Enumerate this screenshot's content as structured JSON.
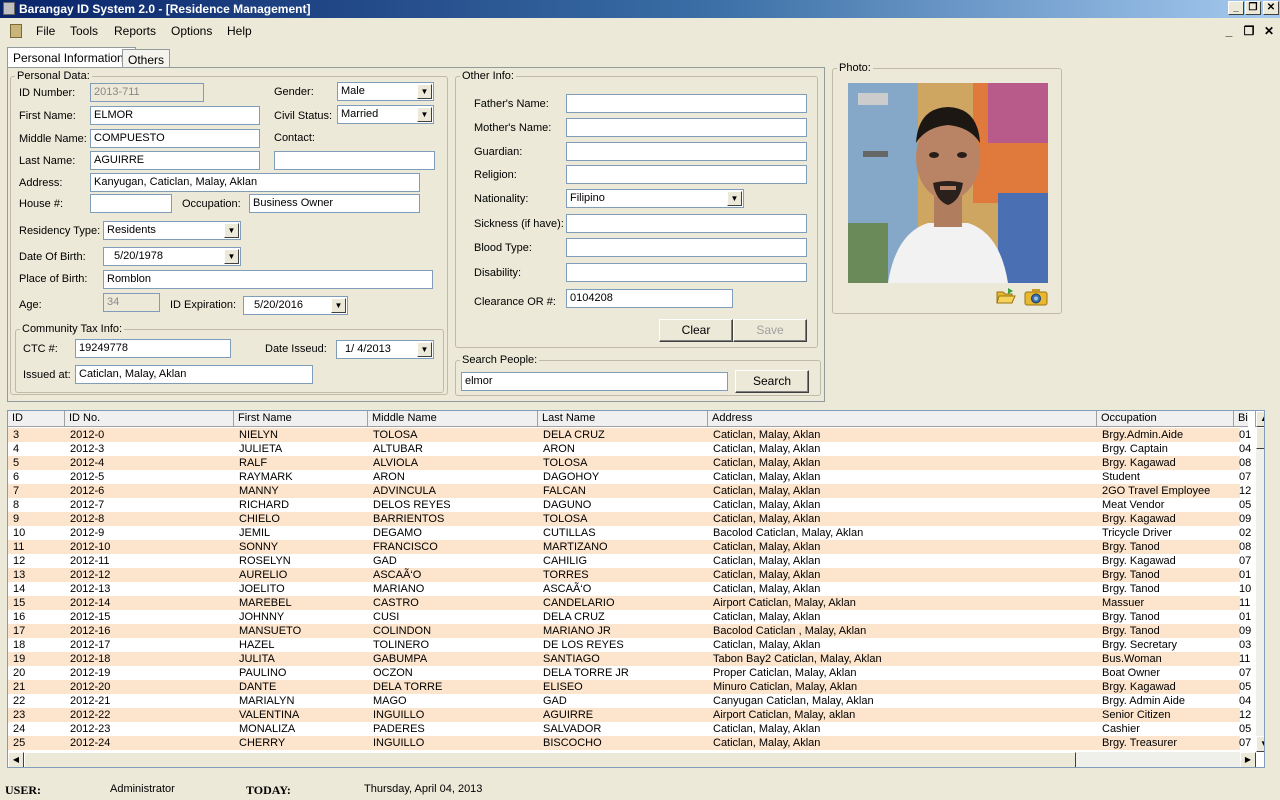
{
  "window": {
    "title": "Barangay ID System 2.0 - [Residence Management]"
  },
  "menu": [
    "File",
    "Tools",
    "Reports",
    "Options",
    "Help"
  ],
  "tabs": [
    "Personal Informations",
    "Others"
  ],
  "personal": {
    "legend": "Personal Data:",
    "id_label": "ID Number:",
    "id_value": "2013-711",
    "first_label": "First Name:",
    "first_value": "ELMOR",
    "middle_label": "Middle Name:",
    "middle_value": "COMPUESTO",
    "last_label": "Last Name:",
    "last_value": "AGUIRRE",
    "gender_label": "Gender:",
    "gender_value": "Male",
    "civil_label": "Civil Status:",
    "civil_value": "Married",
    "contact_label": "Contact:",
    "contact_value": "",
    "address_label": "Address:",
    "address_value": "Kanyugan, Caticlan, Malay, Aklan",
    "house_label": "House #:",
    "house_value": "",
    "occupation_label": "Occupation:",
    "occupation_value": "Business Owner",
    "residency_label": "Residency Type:",
    "residency_value": "Residents",
    "dob_label": "Date Of Birth:",
    "dob_value": "5/20/1978",
    "pob_label": "Place of Birth:",
    "pob_value": "Romblon",
    "age_label": "Age:",
    "age_value": "34",
    "idexp_label": "ID Expiration:",
    "idexp_value": "5/20/2016"
  },
  "ctc": {
    "legend": "Community Tax Info:",
    "ctc_label": "CTC #:",
    "ctc_value": "19249778",
    "issued_date_label": "Date Isseud:",
    "issued_date_value": "1/ 4/2013",
    "issued_at_label": "Issued at:",
    "issued_at_value": "Caticlan, Malay, Aklan"
  },
  "other": {
    "legend": "Other Info:",
    "father_label": "Father's Name:",
    "father_value": "",
    "mother_label": "Mother's Name:",
    "mother_value": "",
    "guardian_label": "Guardian:",
    "guardian_value": "",
    "religion_label": "Religion:",
    "religion_value": "",
    "nationality_label": "Nationality:",
    "nationality_value": "Filipino",
    "sickness_label": "Sickness (if have):",
    "sickness_value": "",
    "blood_label": "Blood Type:",
    "blood_value": "",
    "disability_label": "Disability:",
    "disability_value": "",
    "clearance_label": "Clearance OR #:",
    "clearance_value": "0104208",
    "clear_btn": "Clear",
    "save_btn": "Save"
  },
  "search": {
    "legend": "Search People:",
    "value": "elmor",
    "button": "Search"
  },
  "photo": {
    "legend": "Photo:",
    "open_icon": "folder-open-icon",
    "camera_icon": "camera-icon"
  },
  "grid": {
    "columns": [
      "ID",
      "ID No.",
      "First Name",
      "Middle Name",
      "Last Name",
      "Address",
      "Occupation",
      "Bi"
    ],
    "rows": [
      [
        "3",
        "2012-0",
        "NIELYN",
        "TOLOSA",
        "DELA CRUZ",
        "Caticlan, Malay, Aklan",
        "Brgy.Admin.Aide",
        "01"
      ],
      [
        "4",
        "2012-3",
        "JULIETA",
        "ALTUBAR",
        "ARON",
        "Caticlan, Malay, Aklan",
        "Brgy. Captain",
        "04"
      ],
      [
        "5",
        "2012-4",
        "RALF",
        "ALVIOLA",
        "TOLOSA",
        "Caticlan, Malay, Aklan",
        "Brgy. Kagawad",
        "08"
      ],
      [
        "6",
        "2012-5",
        "RAYMARK",
        "ARON",
        "DAGOHOY",
        "Caticlan, Malay, Aklan",
        "Student",
        "07"
      ],
      [
        "7",
        "2012-6",
        "MANNY",
        "ADVINCULA",
        "FALCAN",
        "Caticlan, Malay, Aklan",
        "2GO Travel Employee",
        "12"
      ],
      [
        "8",
        "2012-7",
        "RICHARD",
        "DELOS REYES",
        "DAGUNO",
        "Caticlan, Malay, Aklan",
        "Meat Vendor",
        "05"
      ],
      [
        "9",
        "2012-8",
        "CHIELO",
        "BARRIENTOS",
        "TOLOSA",
        "Caticlan, Malay, Aklan",
        "Brgy. Kagawad",
        "09"
      ],
      [
        "10",
        "2012-9",
        "JEMIL",
        "DEGAMO",
        "CUTILLAS",
        "Bacolod Caticlan, Malay, Aklan",
        "Tricycle Driver",
        "02"
      ],
      [
        "11",
        "2012-10",
        "SONNY",
        "FRANCISCO",
        "MARTIZANO",
        "Caticlan, Malay, Aklan",
        "Brgy. Tanod",
        "08"
      ],
      [
        "12",
        "2012-11",
        "ROSELYN",
        "GAD",
        "CAHILIG",
        "Caticlan, Malay, Aklan",
        "Brgy. Kagawad",
        "07"
      ],
      [
        "13",
        "2012-12",
        "AURELIO",
        "ASCAÃ‘O",
        "TORRES",
        "Caticlan, Malay, Aklan",
        "Brgy. Tanod",
        "01"
      ],
      [
        "14",
        "2012-13",
        "JOELITO",
        "MARIANO",
        "ASCAÃ‘O",
        "Caticlan, Malay, Aklan",
        "Brgy. Tanod",
        "10"
      ],
      [
        "15",
        "2012-14",
        "MAREBEL",
        "CASTRO",
        "CANDELARIO",
        "Airport Caticlan, Malay, Aklan",
        "Massuer",
        "11"
      ],
      [
        "16",
        "2012-15",
        "JOHNNY",
        "CUSI",
        "DELA CRUZ",
        "Caticlan, Malay, Aklan",
        "Brgy. Tanod",
        "01"
      ],
      [
        "17",
        "2012-16",
        "MANSUETO",
        "COLINDON",
        "MARIANO JR",
        "Bacolod Caticlan , Malay, Aklan",
        "Brgy. Tanod",
        "09"
      ],
      [
        "18",
        "2012-17",
        "HAZEL",
        "TOLINERO",
        "DE LOS REYES",
        "Caticlan, Malay, Aklan",
        "Brgy. Secretary",
        "03"
      ],
      [
        "19",
        "2012-18",
        "JULITA",
        "GABUMPA",
        "SANTIAGO",
        "Tabon Bay2 Caticlan, Malay, Aklan",
        "Bus.Woman",
        "11"
      ],
      [
        "20",
        "2012-19",
        "PAULINO",
        "OCZON",
        "DELA TORRE JR",
        "Proper Caticlan, Malay, Aklan",
        "Boat Owner",
        "07"
      ],
      [
        "21",
        "2012-20",
        "DANTE",
        "DELA  TORRE",
        "ELISEO",
        "Minuro Caticlan, Malay, Aklan",
        "Brgy. Kagawad",
        "05"
      ],
      [
        "22",
        "2012-21",
        "MARIALYN",
        "MAGO",
        "GAD",
        "Canyugan Caticlan, Malay, Aklan",
        "Brgy. Admin Aide",
        "04"
      ],
      [
        "23",
        "2012-22",
        "VALENTINA",
        "INGUILLO",
        "AGUIRRE",
        "Airport Caticlan, Malay, aklan",
        "Senior Citizen",
        "12"
      ],
      [
        "24",
        "2012-23",
        "MONALIZA",
        "PADERES",
        "SALVADOR",
        "Caticlan, Malay, Aklan",
        "Cashier",
        "05"
      ],
      [
        "25",
        "2012-24",
        "CHERRY",
        "INGUILLO",
        "BISCOCHO",
        "Caticlan, Malay, Aklan",
        "Brgy. Treasurer",
        "07"
      ]
    ]
  },
  "status": {
    "user_label": "USER:",
    "user_value": "Administrator",
    "today_label": "TODAY:",
    "today_value": "Thursday, April 04, 2013"
  },
  "colors": {
    "row_alt": "#fde4cc",
    "title_start": "#0a246a"
  }
}
